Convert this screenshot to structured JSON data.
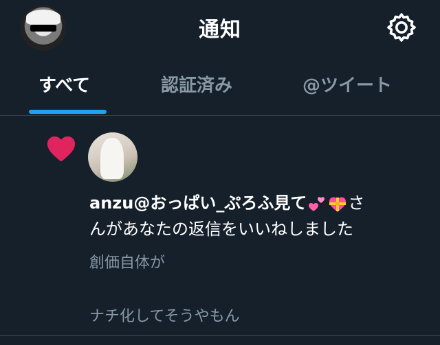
{
  "header": {
    "title": "通知",
    "settings_icon": "gear-icon",
    "avatar_icon": "profile-avatar"
  },
  "tabs": [
    {
      "label": "すべて",
      "active": true
    },
    {
      "label": "認証済み",
      "active": false
    },
    {
      "label": "@ツイート",
      "active": false
    }
  ],
  "notification": {
    "type_icon": "heart-icon",
    "type_color": "#e0245e",
    "user_name": "anzu@おっぱい_ぷろふ見て",
    "emoji_1": "two-hearts-emoji",
    "emoji_2": "heart-with-ribbon-emoji",
    "action_text_1": "さ",
    "action_text_2": "んがあなたの返信をいいねしました",
    "quoted_line_1": "創価自体が",
    "quoted_line_2": "ナチ化してそうやもん"
  },
  "colors": {
    "background": "#15202b",
    "accent": "#1da1f2",
    "muted_text": "#8899a6",
    "divider": "#38444d"
  }
}
